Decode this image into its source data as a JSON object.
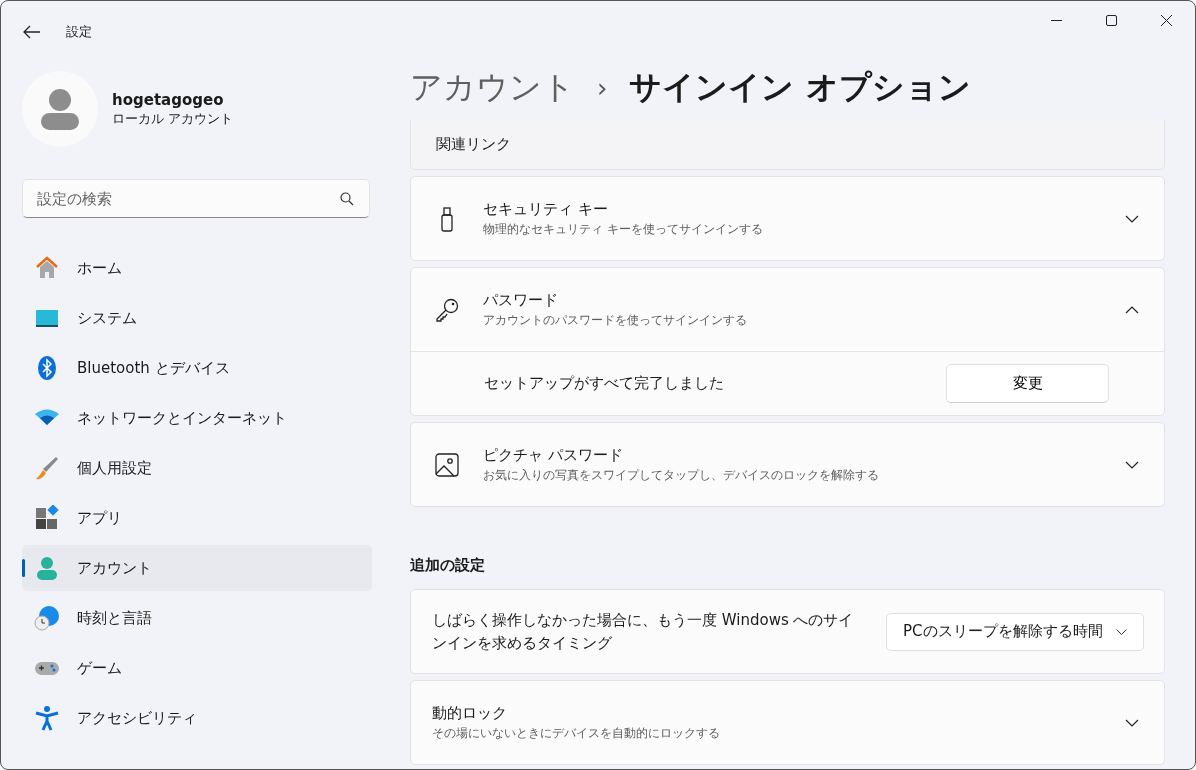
{
  "window": {
    "title": "設定"
  },
  "profile": {
    "name": "hogetagogeo",
    "account_type": "ローカル アカウント"
  },
  "search": {
    "placeholder": "設定の検索"
  },
  "sidebar": {
    "items": [
      {
        "label": "ホーム",
        "kind": "home",
        "selected": false
      },
      {
        "label": "システム",
        "kind": "system",
        "selected": false
      },
      {
        "label": "Bluetooth とデバイス",
        "kind": "bluetooth",
        "selected": false
      },
      {
        "label": "ネットワークとインターネット",
        "kind": "network",
        "selected": false
      },
      {
        "label": "個人用設定",
        "kind": "personalization",
        "selected": false
      },
      {
        "label": "アプリ",
        "kind": "apps",
        "selected": false
      },
      {
        "label": "アカウント",
        "kind": "accounts",
        "selected": true
      },
      {
        "label": "時刻と言語",
        "kind": "time",
        "selected": false
      },
      {
        "label": "ゲーム",
        "kind": "gaming",
        "selected": false
      },
      {
        "label": "アクセシビリティ",
        "kind": "accessibility",
        "selected": false
      }
    ]
  },
  "breadcrumb": {
    "parent": "アカウント",
    "separator": "›",
    "current": "サインイン オプション"
  },
  "related_links": {
    "title": "関連リンク"
  },
  "signin_methods": [
    {
      "title": "セキュリティ キー",
      "description": "物理的なセキュリティ キーを使ってサインインする",
      "kind": "securitykey",
      "expanded": false
    },
    {
      "title": "パスワード",
      "description": "アカウントのパスワードを使ってサインインする",
      "kind": "password",
      "expanded": true,
      "detail": {
        "text": "セットアップがすべて完了しました",
        "button": "変更"
      }
    },
    {
      "title": "ピクチャ パスワード",
      "description": "お気に入りの写真をスワイプしてタップし、デバイスのロックを解除する",
      "kind": "picturepassword",
      "expanded": false
    }
  ],
  "additional_settings": {
    "heading": "追加の設定",
    "items": [
      {
        "kind": "dropdown",
        "title": "しばらく操作しなかった場合に、もう一度 Windows へのサインインを求めるタイミング",
        "value": "PCのスリープを解除する時間"
      },
      {
        "kind": "expander",
        "title": "動的ロック",
        "description": "その場にいないときにデバイスを自動的にロックする",
        "expanded": false
      }
    ]
  }
}
